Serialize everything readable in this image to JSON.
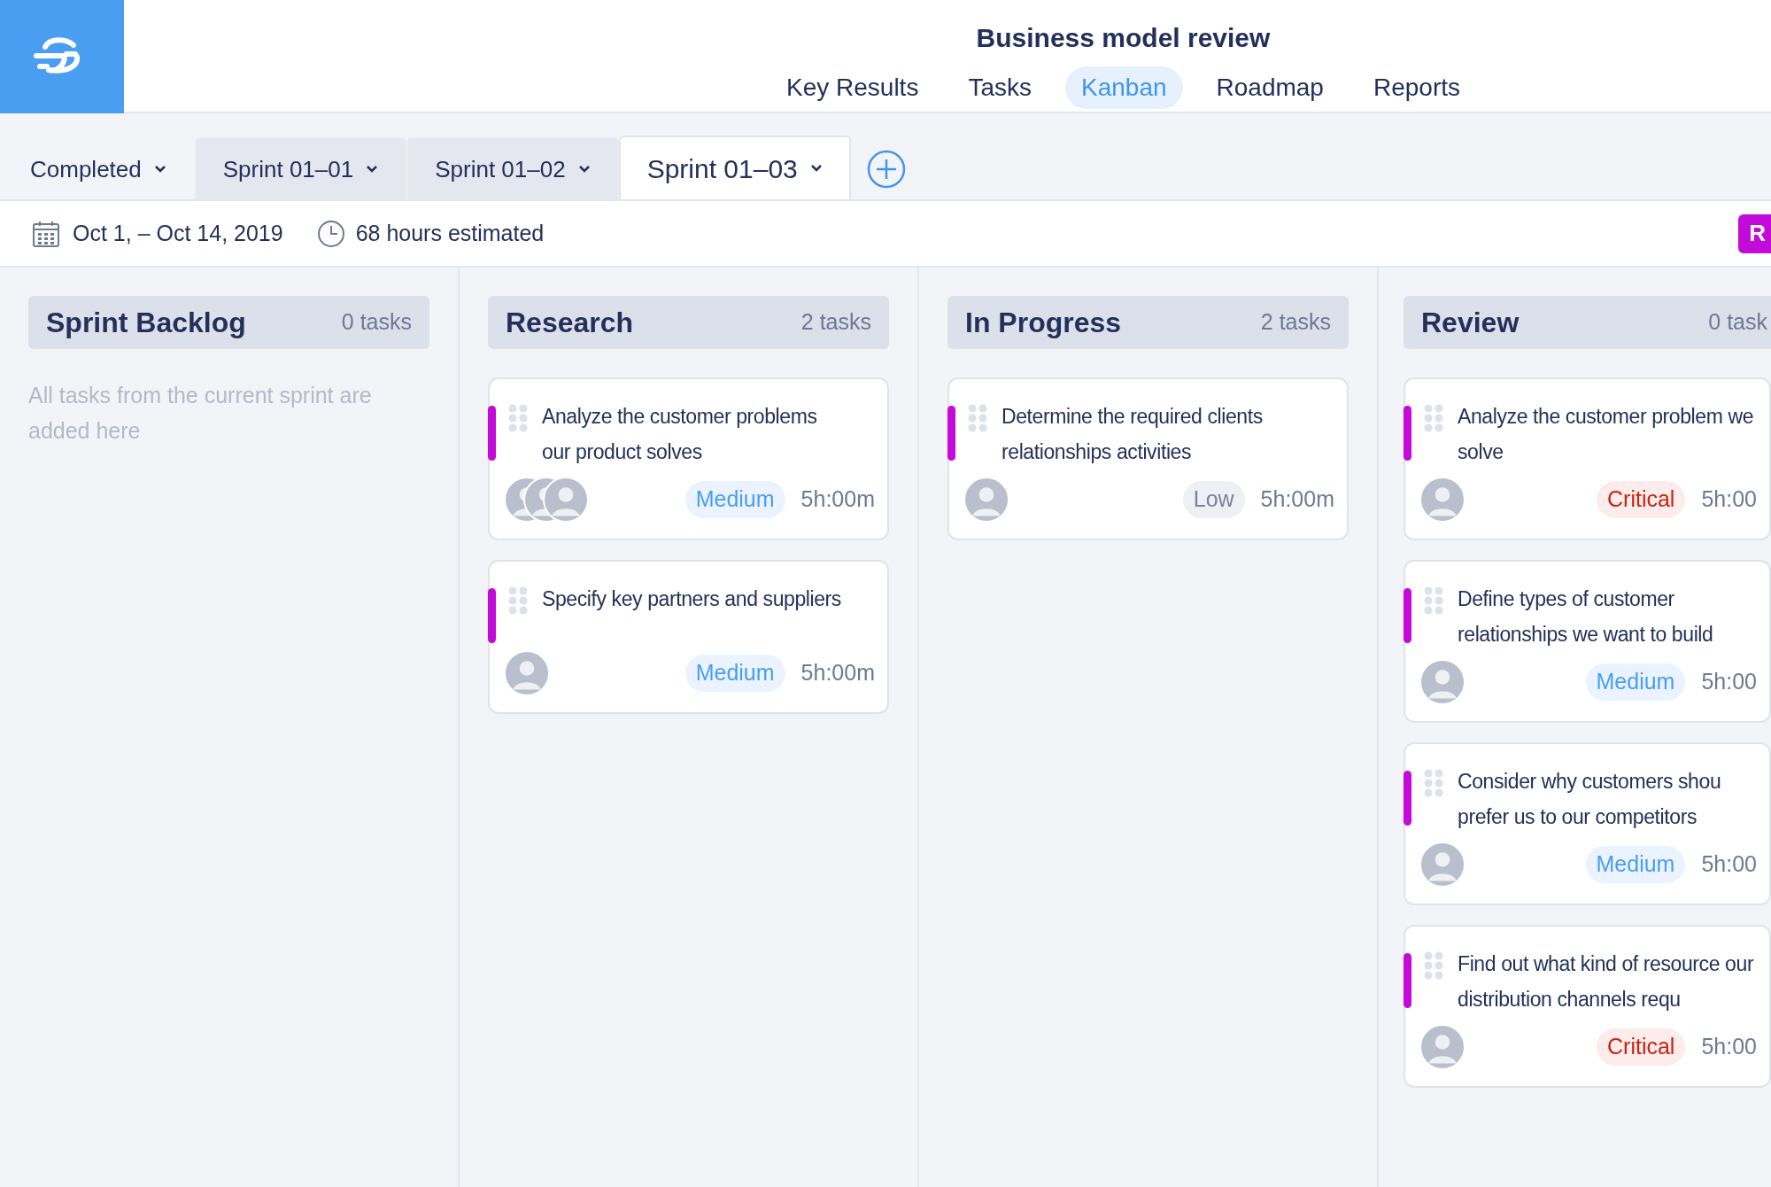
{
  "header": {
    "title": "Business model review",
    "nav": [
      {
        "label": "Key Results",
        "selected": false
      },
      {
        "label": "Tasks",
        "selected": false
      },
      {
        "label": "Kanban",
        "selected": true
      },
      {
        "label": "Roadmap",
        "selected": false
      },
      {
        "label": "Reports",
        "selected": false
      }
    ]
  },
  "sprint_tabs": [
    {
      "label": "Completed",
      "kind": "plain",
      "selected": false
    },
    {
      "label": "Sprint 01–01",
      "kind": "sprint",
      "selected": false
    },
    {
      "label": "Sprint 01–02",
      "kind": "sprint",
      "selected": false
    },
    {
      "label": "Sprint 01–03",
      "kind": "sprint",
      "selected": true
    }
  ],
  "info": {
    "dates": "Oct 1, – Oct 14, 2019",
    "estimate": "68 hours estimated",
    "action": "R"
  },
  "columns": [
    {
      "title": "Sprint Backlog",
      "count": "0 tasks",
      "empty_text": "All tasks from the current sprint are added here"
    },
    {
      "title": "Research",
      "count": "2 tasks",
      "cards": [
        {
          "title": "Analyze the customer problems our product solves",
          "group": true,
          "priority": "Medium",
          "kind": "medium",
          "time": "5h:00m"
        },
        {
          "title": "Specify key partners and suppliers",
          "group": false,
          "priority": "Medium",
          "kind": "medium",
          "time": "5h:00m"
        }
      ]
    },
    {
      "title": "In Progress",
      "count": "2 tasks",
      "cards": [
        {
          "title": "Determine the required clients relationships activities",
          "group": false,
          "priority": "Low",
          "kind": "low",
          "time": "5h:00m"
        }
      ]
    },
    {
      "title": "Review",
      "count": "0 task",
      "cards": [
        {
          "title": "Analyze the customer problem we solve",
          "group": false,
          "priority": "Critical",
          "kind": "critical",
          "time": "5h:00"
        },
        {
          "title": "Define types of customer relationships we want to build",
          "group": false,
          "priority": "Medium",
          "kind": "medium",
          "time": "5h:00"
        },
        {
          "title": "Consider why customers shou prefer us to our competitors",
          "group": false,
          "priority": "Medium",
          "kind": "medium",
          "time": "5h:00"
        },
        {
          "title": "Find out what kind of resource our distribution channels requ",
          "group": false,
          "priority": "Critical",
          "kind": "critical",
          "time": "5h:00"
        }
      ]
    }
  ]
}
